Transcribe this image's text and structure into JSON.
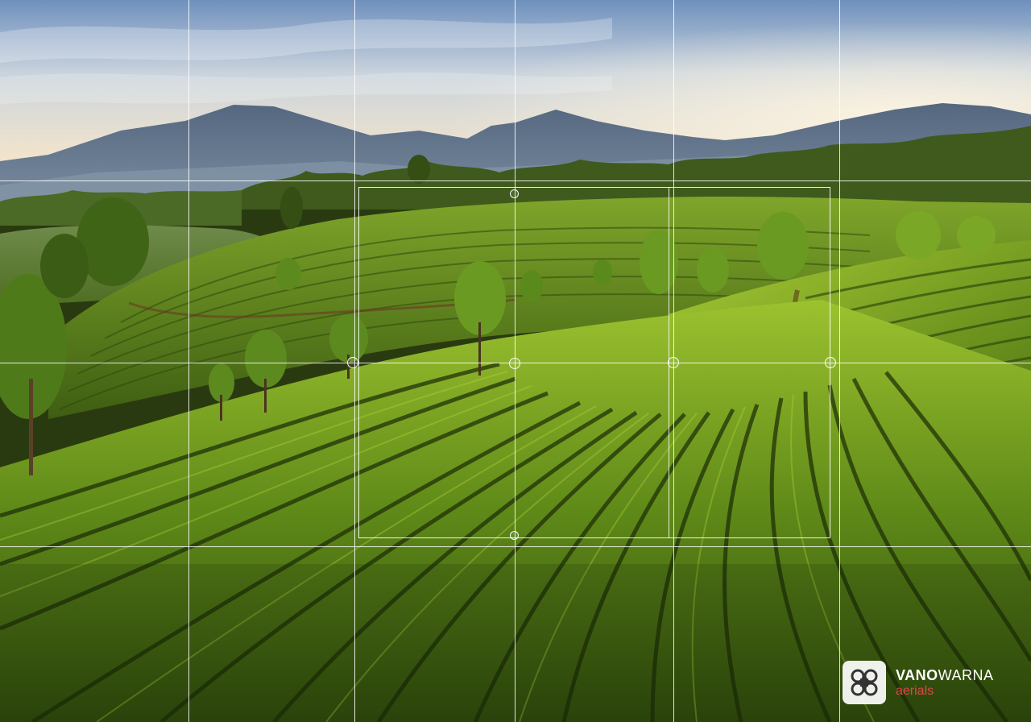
{
  "photo": {
    "subject": "tea-plantation-hills",
    "colors": {
      "sky_top": "#5f86b6",
      "sky_glow": "#f3e6d0",
      "mountain_far": "#8c9cb0",
      "mountain_mid": "#4d5f78",
      "hill_green": "#5d8a1e",
      "row_light": "#8bb828",
      "row_dark": "#1d2c08"
    }
  },
  "overlay": {
    "grid": "thirds-and-sixths",
    "crop_box": "active",
    "handle_icon": "circle-handle-icon"
  },
  "watermark": {
    "logo_icon": "quadcopter-logo-icon",
    "brand_bold": "VANO",
    "brand_regular": "WARNA",
    "subtitle": "aerials",
    "subtitle_color": "#e64545"
  }
}
